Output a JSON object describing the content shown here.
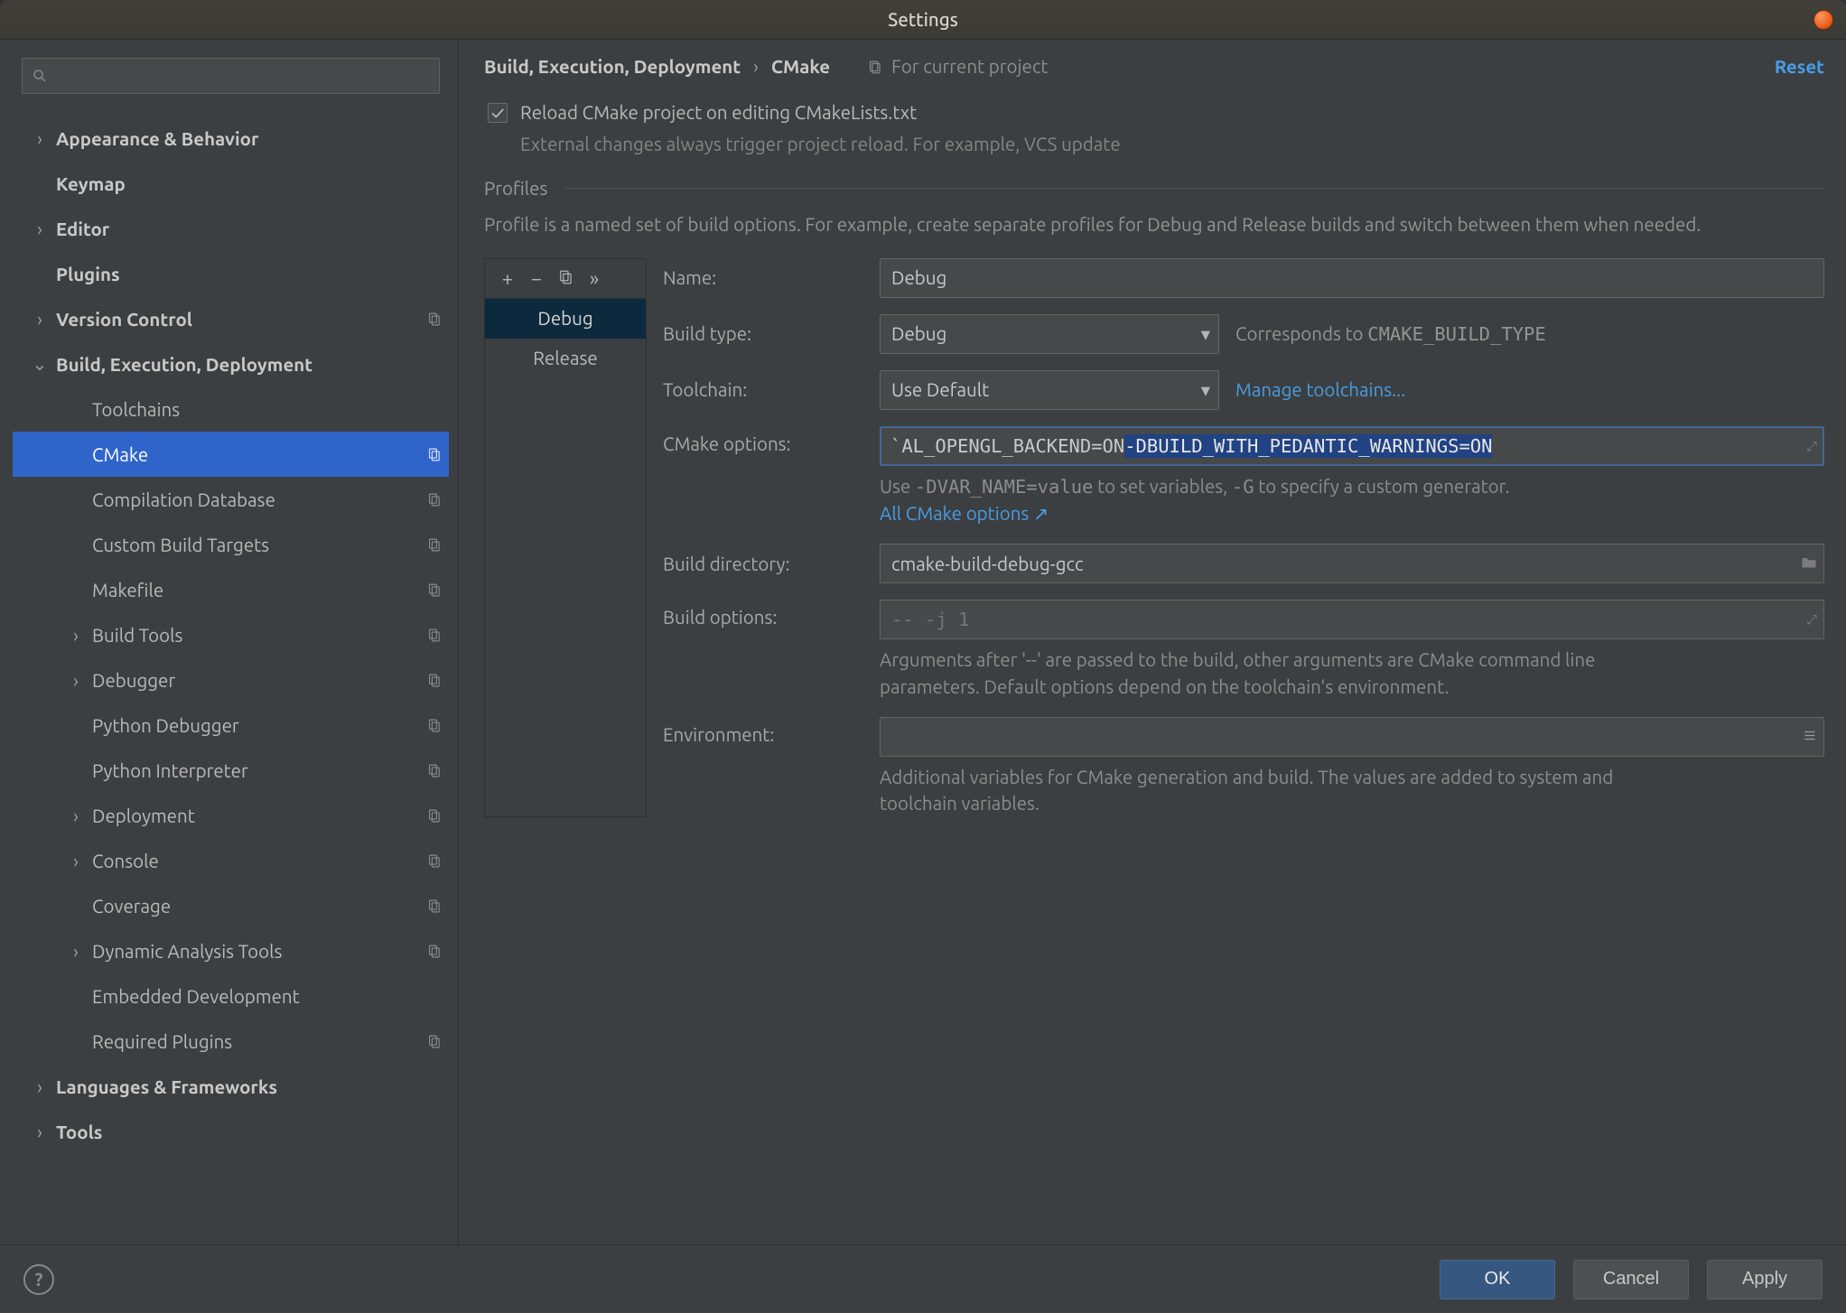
{
  "window": {
    "title": "Settings"
  },
  "search": {
    "placeholder": ""
  },
  "sidebar": {
    "items": [
      {
        "label": "Appearance & Behavior",
        "level": 1,
        "expandable": true,
        "expanded": false
      },
      {
        "label": "Keymap",
        "level": 1,
        "expandable": false
      },
      {
        "label": "Editor",
        "level": 1,
        "expandable": true,
        "expanded": false
      },
      {
        "label": "Plugins",
        "level": 1,
        "expandable": false
      },
      {
        "label": "Version Control",
        "level": 1,
        "expandable": true,
        "expanded": false,
        "copy": true
      },
      {
        "label": "Build, Execution, Deployment",
        "level": 1,
        "expandable": true,
        "expanded": true
      },
      {
        "label": "Toolchains",
        "level": 2
      },
      {
        "label": "CMake",
        "level": 2,
        "selected": true,
        "copy": true
      },
      {
        "label": "Compilation Database",
        "level": 2,
        "copy": true
      },
      {
        "label": "Custom Build Targets",
        "level": 2,
        "copy": true
      },
      {
        "label": "Makefile",
        "level": 2,
        "copy": true
      },
      {
        "label": "Build Tools",
        "level": 3,
        "expandable": true,
        "expanded": false,
        "copy": true
      },
      {
        "label": "Debugger",
        "level": 3,
        "expandable": true,
        "expanded": false,
        "copy": true
      },
      {
        "label": "Python Debugger",
        "level": 2,
        "copy": true
      },
      {
        "label": "Python Interpreter",
        "level": 2,
        "copy": true
      },
      {
        "label": "Deployment",
        "level": 3,
        "expandable": true,
        "expanded": false,
        "copy": true
      },
      {
        "label": "Console",
        "level": 3,
        "expandable": true,
        "expanded": false,
        "copy": true
      },
      {
        "label": "Coverage",
        "level": 2,
        "copy": true
      },
      {
        "label": "Dynamic Analysis Tools",
        "level": 3,
        "expandable": true,
        "expanded": false,
        "copy": true
      },
      {
        "label": "Embedded Development",
        "level": 2
      },
      {
        "label": "Required Plugins",
        "level": 2,
        "copy": true
      },
      {
        "label": "Languages & Frameworks",
        "level": 1,
        "expandable": true,
        "expanded": false
      },
      {
        "label": "Tools",
        "level": 1,
        "expandable": true,
        "expanded": false
      }
    ]
  },
  "breadcrumb": {
    "segment1": "Build, Execution, Deployment",
    "segment2": "CMake",
    "forProject": "For current project",
    "reset": "Reset"
  },
  "reloadCheckbox": {
    "checked": true,
    "label": "Reload CMake project on editing CMakeLists.txt",
    "hint": "External changes always trigger project reload. For example, VCS update"
  },
  "profilesSection": {
    "title": "Profiles",
    "desc": "Profile is a named set of build options. For example, create separate profiles for Debug and Release builds and switch between them when needed."
  },
  "profilesList": [
    "Debug",
    "Release"
  ],
  "profilesSelected": 0,
  "form": {
    "name": {
      "label": "Name:",
      "value": "Debug"
    },
    "buildType": {
      "label": "Build type:",
      "value": "Debug",
      "after": "Corresponds to ",
      "afterMono": "CMAKE_BUILD_TYPE"
    },
    "toolchain": {
      "label": "Toolchain:",
      "value": "Use Default",
      "manageLink": "Manage toolchains..."
    },
    "cmakeOptions": {
      "label": "CMake options:",
      "prefixVisible": "`AL_OPENGL_BACKEND=ON ",
      "selectedVisible": "-DBUILD_WITH_PEDANTIC_WARNINGS=ON",
      "hint1": "Use ",
      "hintMono": "-DVAR_NAME=value",
      "hint2": " to set variables, ",
      "hintMono2": "-G",
      "hint3": " to specify a custom generator.",
      "allLink": "All CMake options ↗"
    },
    "buildDir": {
      "label": "Build directory:",
      "value": "cmake-build-debug-gcc"
    },
    "buildOptions": {
      "label": "Build options:",
      "placeholder": "-- -j 1",
      "hint": "Arguments after '--' are passed to the build, other arguments are CMake command line parameters. Default options depend on the toolchain's environment."
    },
    "environment": {
      "label": "Environment:",
      "value": "",
      "hint": "Additional variables for CMake generation and build. The values are added to system and toolchain variables."
    }
  },
  "footer": {
    "ok": "OK",
    "cancel": "Cancel",
    "apply": "Apply"
  }
}
